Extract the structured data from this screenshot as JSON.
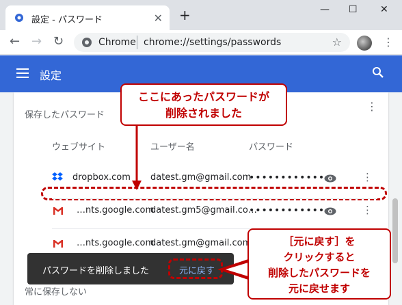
{
  "tab": {
    "title": "設定 - パスワード",
    "favicon": "gear-icon"
  },
  "window": {
    "minimize": "—",
    "maximize": "☐",
    "close": "✕"
  },
  "omnibox": {
    "scheme": "Chrome",
    "url": "chrome://settings/passwords"
  },
  "header": {
    "title": "設定"
  },
  "section": {
    "title": "保存したパスワード"
  },
  "columns": {
    "website": "ウェブサイト",
    "username": "ユーザー名",
    "password": "パスワード"
  },
  "rows": [
    {
      "site": "dropbox.com",
      "user": "datest.gm@gmail.com",
      "password": "••••••••••••",
      "icon": "dropbox-icon"
    },
    {
      "site": "…nts.google.com",
      "user": "datest.gm5@gmail.co…",
      "password": "••••••••••••",
      "icon": "gmail-icon"
    },
    {
      "site": "…nts.google.com",
      "user": "datest.gm@gmail.com",
      "password": "",
      "icon": "gmail-icon"
    }
  ],
  "toast": {
    "message": "パスワードを削除しました",
    "undo": "元に戻す"
  },
  "footer": {
    "text": "常に保存しない"
  },
  "callouts": {
    "top": [
      "ここにあったパスワードが",
      "削除されました"
    ],
    "bottom": [
      "［元に戻す］を",
      "クリックすると",
      "削除したパスワードを",
      "元に戻せます"
    ]
  },
  "colors": {
    "accent": "#3367d6",
    "callout": "#c00000",
    "toast_link": "#8ab4f8"
  }
}
